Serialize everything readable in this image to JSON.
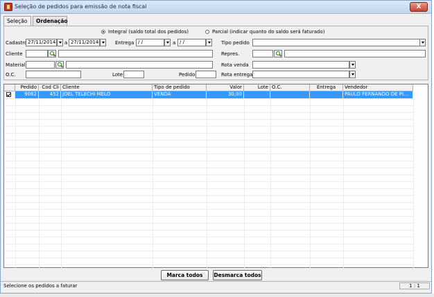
{
  "window": {
    "title": "Seleção de pedidos para emissão de nota fiscal",
    "close_label": "X"
  },
  "tabs": [
    {
      "label": "Seleção",
      "active": true
    },
    {
      "label": "Ordenação",
      "active": false
    }
  ],
  "filters": {
    "radio_integral": "Integral (saldo total dos pedidos)",
    "radio_parcial": "Parcial (indicar quanto do saldo será faturado)",
    "cadastro_label": "Cadastro",
    "cadastro_from": "27/11/2014",
    "cadastro_sep": "a",
    "cadastro_to": "27/11/2014",
    "entrega_label": "Entrega",
    "entrega_from": " /  / ",
    "entrega_sep": "a",
    "entrega_to": " /  / ",
    "cliente_label": "Cliente",
    "cliente_code": "",
    "cliente_name": "",
    "material_label": "Material",
    "material_code": "",
    "material_name": "",
    "oc_label": "O.C.",
    "oc_value": "",
    "lote_label": "Lote",
    "lote_value": "",
    "pedido_label": "Pedido",
    "pedido_value": "",
    "tipo_pedido_label": "Tipo pedido",
    "tipo_pedido_value": "",
    "repres_label": "Repres.",
    "repres_code": "",
    "repres_name": "",
    "rota_venda_label": "Rota venda",
    "rota_venda_value": "",
    "rota_entrega_label": "Rota entrega",
    "rota_entrega_value": ""
  },
  "table": {
    "columns": [
      "",
      "Pedido",
      "Cod Cli",
      "Cliente",
      "Tipo de pedido",
      "Valor",
      "Lote",
      "O.C.",
      "Entrega",
      "Vendedor"
    ],
    "rows": [
      {
        "checked": true,
        "pedido": "9062",
        "cod_cli": "452",
        "cliente": "JOEL TELECHI MELO",
        "tipo": "VENDA",
        "valor": "30,00",
        "lote": "",
        "oc": "",
        "entrega": "",
        "vendedor": "PAULO FERNANDO DE PI..."
      }
    ]
  },
  "buttons": {
    "marca_todos": "Marca todos",
    "desmarca_todos": "Desmarca todos"
  },
  "status": {
    "message": "Selecione os pedidos a faturar",
    "position": "1 : 1"
  },
  "colors": {
    "selection": "#3399ff",
    "window_bg": "#f0f0f0",
    "titlebar": "#c4d6ee",
    "close": "#c74532"
  }
}
